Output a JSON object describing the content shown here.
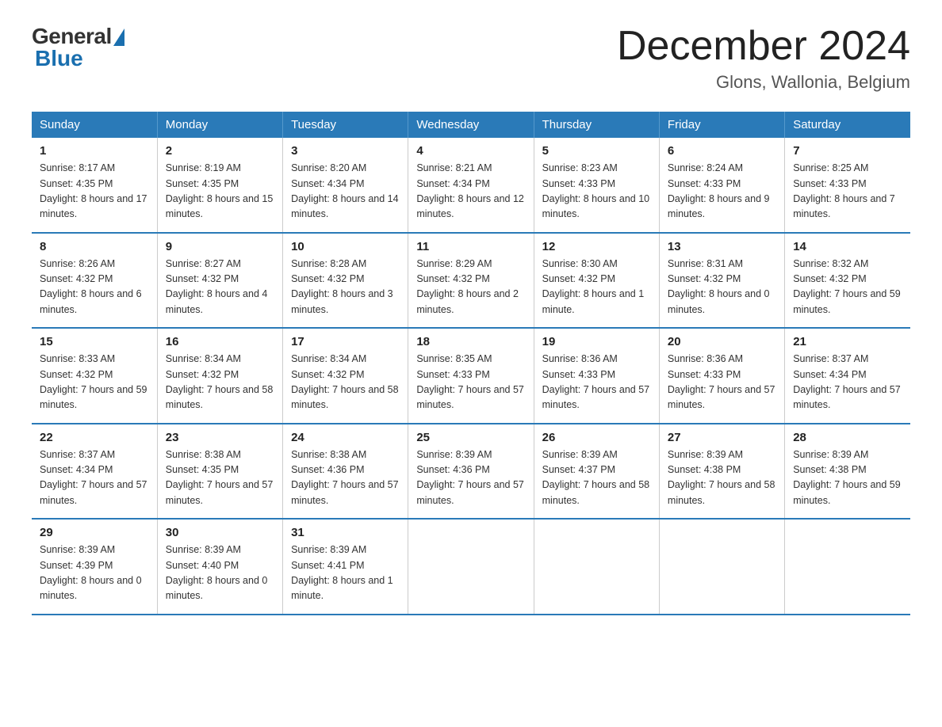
{
  "header": {
    "logo_general": "General",
    "logo_blue": "Blue",
    "month_title": "December 2024",
    "location": "Glons, Wallonia, Belgium"
  },
  "days_of_week": [
    "Sunday",
    "Monday",
    "Tuesday",
    "Wednesday",
    "Thursday",
    "Friday",
    "Saturday"
  ],
  "weeks": [
    [
      {
        "day": "1",
        "sunrise": "8:17 AM",
        "sunset": "4:35 PM",
        "daylight": "8 hours and 17 minutes."
      },
      {
        "day": "2",
        "sunrise": "8:19 AM",
        "sunset": "4:35 PM",
        "daylight": "8 hours and 15 minutes."
      },
      {
        "day": "3",
        "sunrise": "8:20 AM",
        "sunset": "4:34 PM",
        "daylight": "8 hours and 14 minutes."
      },
      {
        "day": "4",
        "sunrise": "8:21 AM",
        "sunset": "4:34 PM",
        "daylight": "8 hours and 12 minutes."
      },
      {
        "day": "5",
        "sunrise": "8:23 AM",
        "sunset": "4:33 PM",
        "daylight": "8 hours and 10 minutes."
      },
      {
        "day": "6",
        "sunrise": "8:24 AM",
        "sunset": "4:33 PM",
        "daylight": "8 hours and 9 minutes."
      },
      {
        "day": "7",
        "sunrise": "8:25 AM",
        "sunset": "4:33 PM",
        "daylight": "8 hours and 7 minutes."
      }
    ],
    [
      {
        "day": "8",
        "sunrise": "8:26 AM",
        "sunset": "4:32 PM",
        "daylight": "8 hours and 6 minutes."
      },
      {
        "day": "9",
        "sunrise": "8:27 AM",
        "sunset": "4:32 PM",
        "daylight": "8 hours and 4 minutes."
      },
      {
        "day": "10",
        "sunrise": "8:28 AM",
        "sunset": "4:32 PM",
        "daylight": "8 hours and 3 minutes."
      },
      {
        "day": "11",
        "sunrise": "8:29 AM",
        "sunset": "4:32 PM",
        "daylight": "8 hours and 2 minutes."
      },
      {
        "day": "12",
        "sunrise": "8:30 AM",
        "sunset": "4:32 PM",
        "daylight": "8 hours and 1 minute."
      },
      {
        "day": "13",
        "sunrise": "8:31 AM",
        "sunset": "4:32 PM",
        "daylight": "8 hours and 0 minutes."
      },
      {
        "day": "14",
        "sunrise": "8:32 AM",
        "sunset": "4:32 PM",
        "daylight": "7 hours and 59 minutes."
      }
    ],
    [
      {
        "day": "15",
        "sunrise": "8:33 AM",
        "sunset": "4:32 PM",
        "daylight": "7 hours and 59 minutes."
      },
      {
        "day": "16",
        "sunrise": "8:34 AM",
        "sunset": "4:32 PM",
        "daylight": "7 hours and 58 minutes."
      },
      {
        "day": "17",
        "sunrise": "8:34 AM",
        "sunset": "4:32 PM",
        "daylight": "7 hours and 58 minutes."
      },
      {
        "day": "18",
        "sunrise": "8:35 AM",
        "sunset": "4:33 PM",
        "daylight": "7 hours and 57 minutes."
      },
      {
        "day": "19",
        "sunrise": "8:36 AM",
        "sunset": "4:33 PM",
        "daylight": "7 hours and 57 minutes."
      },
      {
        "day": "20",
        "sunrise": "8:36 AM",
        "sunset": "4:33 PM",
        "daylight": "7 hours and 57 minutes."
      },
      {
        "day": "21",
        "sunrise": "8:37 AM",
        "sunset": "4:34 PM",
        "daylight": "7 hours and 57 minutes."
      }
    ],
    [
      {
        "day": "22",
        "sunrise": "8:37 AM",
        "sunset": "4:34 PM",
        "daylight": "7 hours and 57 minutes."
      },
      {
        "day": "23",
        "sunrise": "8:38 AM",
        "sunset": "4:35 PM",
        "daylight": "7 hours and 57 minutes."
      },
      {
        "day": "24",
        "sunrise": "8:38 AM",
        "sunset": "4:36 PM",
        "daylight": "7 hours and 57 minutes."
      },
      {
        "day": "25",
        "sunrise": "8:39 AM",
        "sunset": "4:36 PM",
        "daylight": "7 hours and 57 minutes."
      },
      {
        "day": "26",
        "sunrise": "8:39 AM",
        "sunset": "4:37 PM",
        "daylight": "7 hours and 58 minutes."
      },
      {
        "day": "27",
        "sunrise": "8:39 AM",
        "sunset": "4:38 PM",
        "daylight": "7 hours and 58 minutes."
      },
      {
        "day": "28",
        "sunrise": "8:39 AM",
        "sunset": "4:38 PM",
        "daylight": "7 hours and 59 minutes."
      }
    ],
    [
      {
        "day": "29",
        "sunrise": "8:39 AM",
        "sunset": "4:39 PM",
        "daylight": "8 hours and 0 minutes."
      },
      {
        "day": "30",
        "sunrise": "8:39 AM",
        "sunset": "4:40 PM",
        "daylight": "8 hours and 0 minutes."
      },
      {
        "day": "31",
        "sunrise": "8:39 AM",
        "sunset": "4:41 PM",
        "daylight": "8 hours and 1 minute."
      },
      null,
      null,
      null,
      null
    ]
  ]
}
